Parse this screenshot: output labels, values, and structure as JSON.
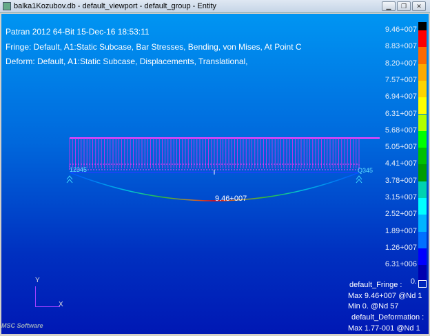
{
  "window": {
    "title": "balka1Kozubov.db - default_viewport - default_group - Entity",
    "minimize": "▁",
    "restore": "❐",
    "close": "✕"
  },
  "header": {
    "line1": "Patran 2012 64-Bit 15-Dec-16 18:53:11",
    "line2": "Fringe: Default, A1:Static Subcase, Bar Stresses, Bending, von Mises, At Point C",
    "line3": "Deform: Default, A1:Static Subcase, Displacements, Translational,"
  },
  "colorbar": {
    "labels": [
      "9.46+007",
      "8.83+007",
      "8.20+007",
      "7.57+007",
      "6.94+007",
      "6.31+007",
      "5.68+007",
      "5.05+007",
      "4.41+007",
      "3.78+007",
      "3.15+007",
      "2.52+007",
      "1.89+007",
      "1.26+007",
      "6.31+006",
      "0."
    ],
    "colors": [
      "#000000",
      "#ff0000",
      "#ff6a00",
      "#ffaa00",
      "#ffd400",
      "#ffff00",
      "#b0ff00",
      "#00ff00",
      "#00c000",
      "#009c00",
      "#00d2b0",
      "#00ffff",
      "#00b4ff",
      "#0070ff",
      "#0000ff",
      "#0000b0"
    ]
  },
  "model": {
    "max_label": "9.46+007",
    "left_node": "12345",
    "right_node": "Q345"
  },
  "legend": {
    "fringe_title": "default_Fringe :",
    "fringe_max": "Max 9.46+007 @Nd 1",
    "fringe_min": "Min  0. @Nd 57",
    "deform_title": "default_Deformation :",
    "deform_max": "Max 1.77-001 @Nd 1"
  },
  "axes": {
    "y": "Y",
    "x": "X"
  },
  "logo": "MSC Software"
}
